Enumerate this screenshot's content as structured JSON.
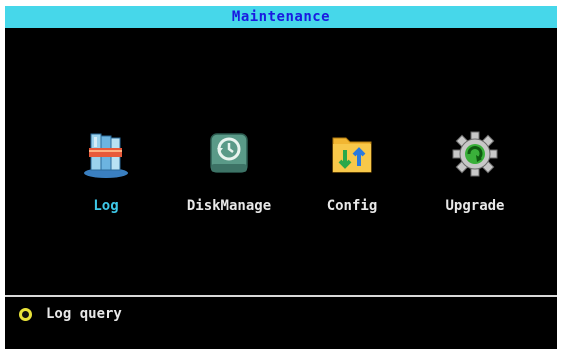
{
  "header": {
    "title": "Maintenance"
  },
  "menu": {
    "items": [
      {
        "label": "Log",
        "icon": "log-books-icon",
        "selected": true
      },
      {
        "label": "DiskManage",
        "icon": "disk-history-icon",
        "selected": false
      },
      {
        "label": "Config",
        "icon": "config-folder-icon",
        "selected": false
      },
      {
        "label": "Upgrade",
        "icon": "upgrade-gear-icon",
        "selected": false
      }
    ]
  },
  "status": {
    "text": "Log query",
    "indicator": "yellow-ring-icon"
  },
  "colors": {
    "title_bar": "#46d7ea",
    "title_text": "#1a1ae0",
    "selected_label": "#3ec8e8",
    "background": "#000000"
  }
}
